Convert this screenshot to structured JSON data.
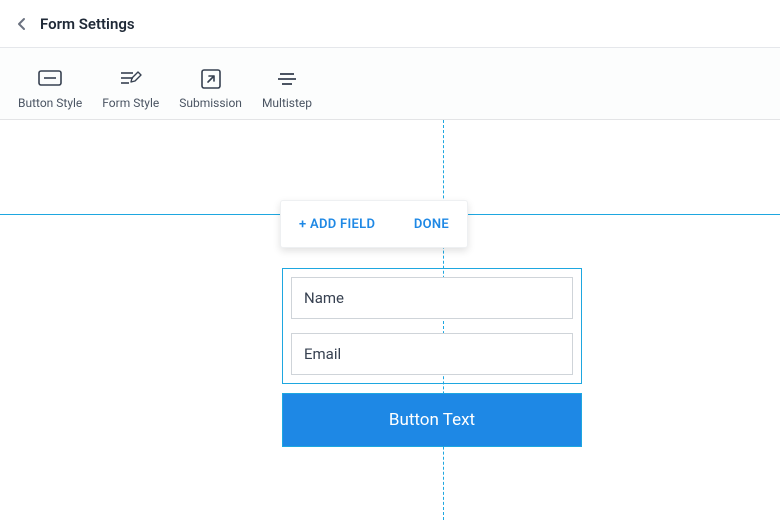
{
  "header": {
    "title": "Form Settings"
  },
  "toolbar": {
    "items": [
      {
        "label": "Button Style"
      },
      {
        "label": "Form Style"
      },
      {
        "label": "Submission"
      },
      {
        "label": "Multistep"
      }
    ]
  },
  "popup": {
    "add_field": "+ ADD FIELD",
    "done": "DONE"
  },
  "form": {
    "fields": [
      {
        "label": "Name"
      },
      {
        "label": "Email"
      }
    ],
    "submit_label": "Button Text"
  }
}
